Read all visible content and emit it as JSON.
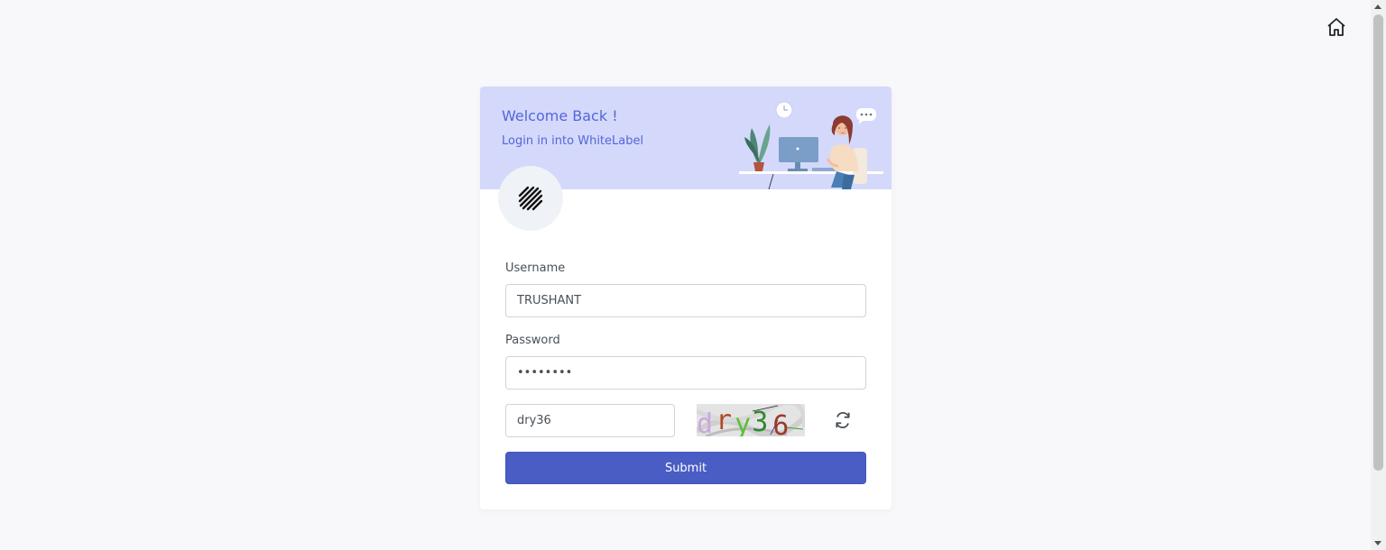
{
  "header": {
    "home_icon": "home-icon"
  },
  "banner": {
    "title": "Welcome Back !",
    "subtitle": "Login in into WhiteLabel"
  },
  "form": {
    "username_label": "Username",
    "username_value": "TRUSHANT",
    "password_label": "Password",
    "password_value": "passwor1",
    "captcha_input_value": "dry36",
    "captcha_image_text": "dry36",
    "refresh_icon": "refresh-icon",
    "submit_label": "Submit"
  },
  "colors": {
    "accent": "#4a5dc4",
    "banner_bg": "#d4d9fb",
    "banner_text": "#5466d8",
    "page_bg": "#f8f8fb"
  }
}
